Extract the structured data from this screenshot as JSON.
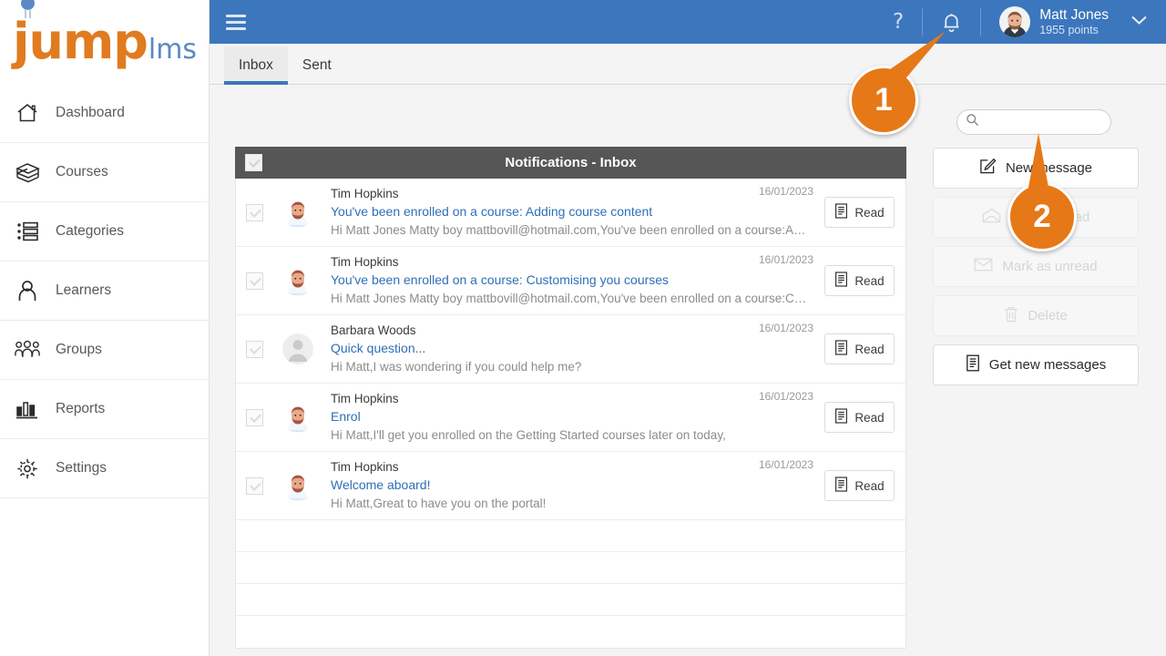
{
  "brand": {
    "logo_primary": "jump",
    "logo_secondary": "lms",
    "orange": "#e07b1f",
    "blue": "#5b89c4"
  },
  "sidebar": {
    "items": [
      {
        "label": "Dashboard",
        "icon": "home-icon"
      },
      {
        "label": "Courses",
        "icon": "books-icon"
      },
      {
        "label": "Categories",
        "icon": "list-icon"
      },
      {
        "label": "Learners",
        "icon": "user-icon"
      },
      {
        "label": "Groups",
        "icon": "group-icon"
      },
      {
        "label": "Reports",
        "icon": "bar-chart-icon"
      },
      {
        "label": "Settings",
        "icon": "gear-icon"
      }
    ]
  },
  "topbar": {
    "menu_icon": "hamburger-icon",
    "help_icon": "question-mark-icon",
    "bell_icon": "bell-icon",
    "user_name": "Matt Jones",
    "user_points": "1955 points",
    "caret_icon": "chevron-down-icon",
    "bar_color": "#3c76bd"
  },
  "tabs": [
    {
      "label": "Inbox",
      "active": true
    },
    {
      "label": "Sent",
      "active": false
    }
  ],
  "search": {
    "value": "",
    "placeholder": "",
    "icon": "search-icon"
  },
  "inbox": {
    "title": "Notifications - Inbox",
    "select_all_checkbox": true,
    "messages": [
      {
        "sender": "Tim Hopkins",
        "subject": "You've been enrolled on a course: Adding course content",
        "preview": "Hi Matt Jones Matty boy mattbovill@hotmail.com,You've been enrolled on a course:Ad...",
        "date": "16/01/2023",
        "action_label": "Read",
        "avatar": "man-beard-avatar"
      },
      {
        "sender": "Tim Hopkins",
        "subject": "You've been enrolled on a course: Customising you courses",
        "preview": "Hi Matt Jones Matty boy mattbovill@hotmail.com,You've been enrolled on a course:Cus...",
        "date": "16/01/2023",
        "action_label": "Read",
        "avatar": "man-beard-avatar"
      },
      {
        "sender": "Barbara Woods",
        "subject": "Quick question...",
        "preview": "Hi Matt,I was wondering if you could help me?",
        "date": "16/01/2023",
        "action_label": "Read",
        "avatar": "generic-user-avatar"
      },
      {
        "sender": "Tim Hopkins",
        "subject": "Enrol",
        "preview": "Hi Matt,I'll get you enrolled on the Getting Started courses later on today,",
        "date": "16/01/2023",
        "action_label": "Read",
        "avatar": "man-beard-avatar"
      },
      {
        "sender": "Tim Hopkins",
        "subject": "Welcome aboard!",
        "preview": "Hi Matt,Great to have you on the portal!",
        "date": "16/01/2023",
        "action_label": "Read",
        "avatar": "man-beard-avatar"
      }
    ],
    "empty_row_count": 4
  },
  "actions": [
    {
      "label": "New message",
      "icon": "compose-icon",
      "disabled": false
    },
    {
      "label": "Mark as read",
      "icon": "open-envelope-icon",
      "disabled": true
    },
    {
      "label": "Mark as unread",
      "icon": "closed-envelope-icon",
      "disabled": true
    },
    {
      "label": "Delete",
      "icon": "trash-icon",
      "disabled": true
    },
    {
      "label": "Get new messages",
      "icon": "document-icon",
      "disabled": false
    }
  ],
  "callouts": [
    {
      "number": "1",
      "target": "bell-icon"
    },
    {
      "number": "2",
      "target": "new-message-button"
    }
  ]
}
